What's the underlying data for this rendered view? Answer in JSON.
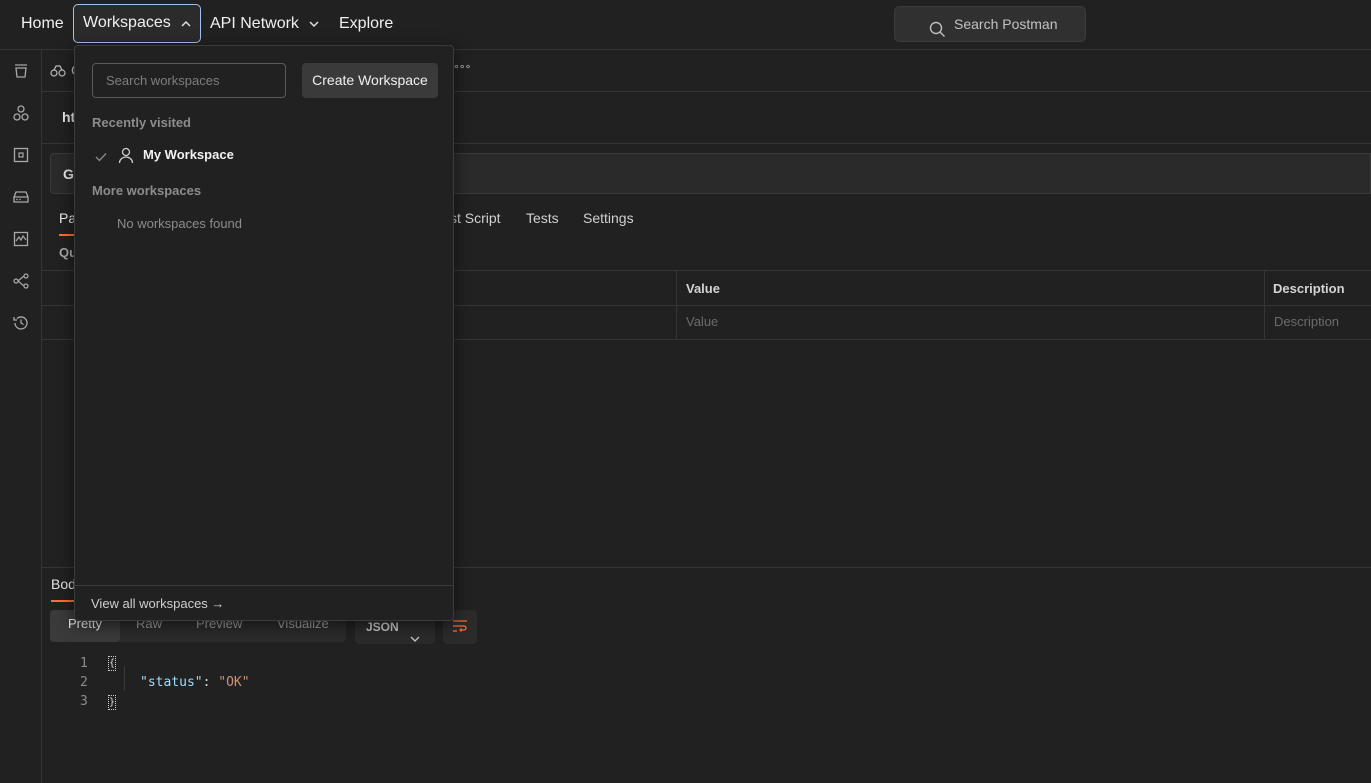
{
  "topnav": {
    "home": "Home",
    "workspaces": "Workspaces",
    "api_network": "API Network",
    "explore": "Explore",
    "search_placeholder": "Search Postman"
  },
  "sidebar": {
    "icons": [
      "collections-icon",
      "apis-icon",
      "environments-icon",
      "mock-servers-icon",
      "monitors-icon",
      "flows-icon",
      "history-icon"
    ]
  },
  "main": {
    "tab_fragment": "G",
    "tab_overflow": "°°°",
    "url_fragment": "ht",
    "method_fragment": "GE",
    "tabs": {
      "params_fragment": "Pa",
      "prerequest_fragment": "st Script",
      "tests": "Tests",
      "settings": "Settings"
    },
    "query_fragment": "Qu",
    "params_table": {
      "columns": [
        "Value",
        "Description"
      ],
      "placeholders": [
        "Value",
        "Description"
      ]
    },
    "response": {
      "body_fragment": "Bod",
      "views": [
        "Pretty",
        "Raw",
        "Preview",
        "Visualize"
      ],
      "active_view": "Pretty",
      "language": "JSON",
      "code_lines": [
        {
          "num": "1",
          "open": "{"
        },
        {
          "num": "2",
          "key": "\"status\"",
          "colon": ": ",
          "value": "\"OK\""
        },
        {
          "num": "3",
          "close": "}"
        }
      ]
    }
  },
  "dropdown": {
    "search_placeholder": "Search workspaces",
    "create_button": "Create Workspace",
    "recent_title": "Recently visited",
    "recent_items": [
      {
        "name": "My Workspace",
        "selected": true
      }
    ],
    "more_title": "More workspaces",
    "empty_text": "No workspaces found",
    "footer_link": "View all workspaces →"
  },
  "colors": {
    "accent": "#ff6c37",
    "focus_ring": "#a4c1ec",
    "json_key": "#9cdcfe",
    "json_string": "#ce9178"
  }
}
